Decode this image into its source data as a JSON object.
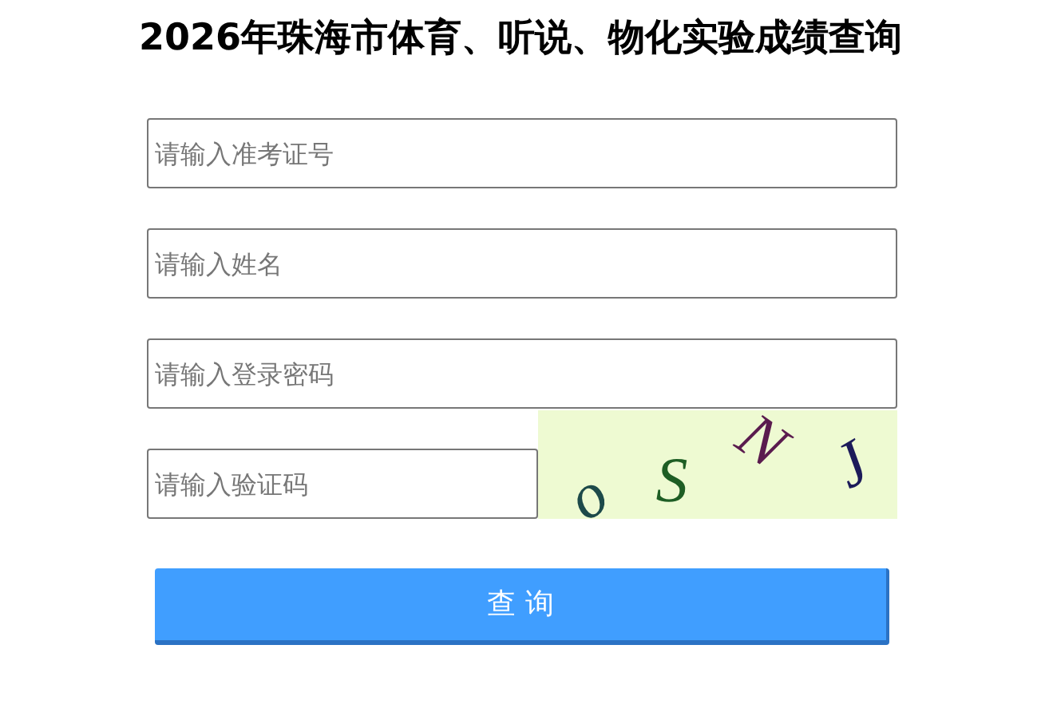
{
  "title": "2026年珠海市体育、听说、物化实验成绩查询",
  "fields": [
    {
      "placeholder": "请输入准考证号"
    },
    {
      "placeholder": "请输入姓名"
    },
    {
      "placeholder": "请输入登录密码"
    }
  ],
  "captcha_field": {
    "placeholder": "请输入验证码"
  },
  "captcha": {
    "characters": [
      {
        "char": "o",
        "color": "#1d4a4a"
      },
      {
        "char": "S",
        "color": "#1e5e24"
      },
      {
        "char": "N",
        "color": "#5a1b4e"
      },
      {
        "char": "J",
        "color": "#1c1b5a"
      }
    ]
  },
  "button": "查 询"
}
